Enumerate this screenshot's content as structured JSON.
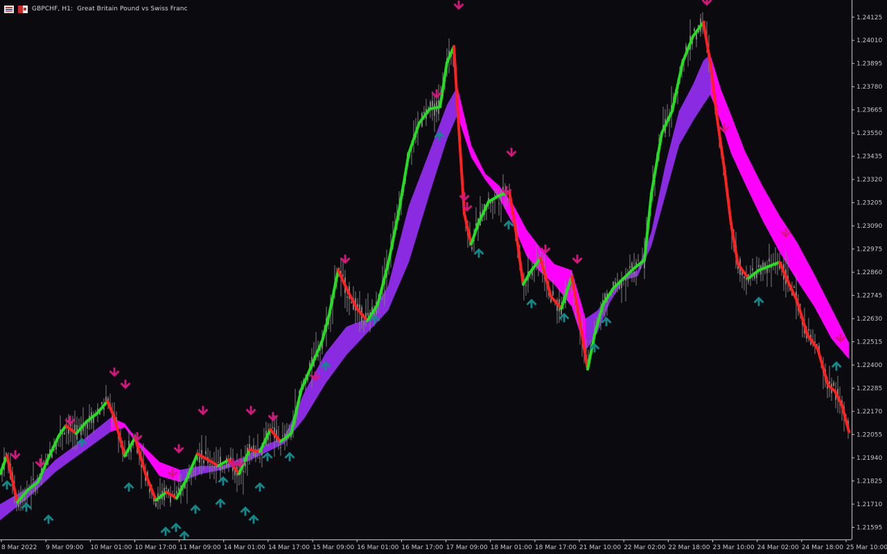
{
  "header": {
    "symbol": "GBPCHF, H1:",
    "description": "Great Britain Pound vs Swiss Franc",
    "icons": [
      "indicator-list-icon",
      "chart-window-icon"
    ]
  },
  "colors": {
    "background": "#0a0a0f",
    "candle": "#7f7f7f",
    "trend_up": "#22e01e",
    "trend_down": "#ff2020",
    "band_up": "#8a2be2",
    "band_down": "#ff00ff",
    "arrow_buy": "#0f8a8a",
    "arrow_sell": "#d8157f",
    "axis": "#c8c8c8"
  },
  "chart_data": {
    "type": "candlestick",
    "symbol": "GBPCHF",
    "timeframe": "H1",
    "y_ticks": [
      "1.24125",
      "1.24010",
      "1.23895",
      "1.23780",
      "1.23665",
      "1.23550",
      "1.23435",
      "1.23320",
      "1.23205",
      "1.23090",
      "1.22975",
      "1.22860",
      "1.22745",
      "1.22630",
      "1.22515",
      "1.22400",
      "1.22285",
      "1.22170",
      "1.22055",
      "1.21940",
      "1.21825",
      "1.21710",
      "1.21595"
    ],
    "ylim": [
      1.21535,
      1.2421
    ],
    "x_ticks": [
      "8 Mar 2022",
      "9 Mar 09:00",
      "10 Mar 01:00",
      "10 Mar 17:00",
      "11 Mar 09:00",
      "14 Mar 01:00",
      "14 Mar 17:00",
      "15 Mar 09:00",
      "16 Mar 01:00",
      "16 Mar 17:00",
      "17 Mar 09:00",
      "18 Mar 01:00",
      "18 Mar 17:00",
      "21 Mar 10:00",
      "22 Mar 02:00",
      "22 Mar 18:00",
      "23 Mar 10:00",
      "24 Mar 02:00",
      "24 Mar 18:00",
      "25 Mar 10:00"
    ],
    "price_path": [
      [
        0,
        1.2186
      ],
      [
        10,
        1.2195
      ],
      [
        25,
        1.2172
      ],
      [
        40,
        1.2178
      ],
      [
        55,
        1.2182
      ],
      [
        70,
        1.2194
      ],
      [
        85,
        1.2205
      ],
      [
        95,
        1.221
      ],
      [
        110,
        1.2206
      ],
      [
        125,
        1.2212
      ],
      [
        140,
        1.2216
      ],
      [
        155,
        1.2222
      ],
      [
        165,
        1.2214
      ],
      [
        180,
        1.2195
      ],
      [
        195,
        1.2204
      ],
      [
        210,
        1.2186
      ],
      [
        225,
        1.2173
      ],
      [
        240,
        1.2177
      ],
      [
        255,
        1.2174
      ],
      [
        270,
        1.2184
      ],
      [
        285,
        1.2196
      ],
      [
        300,
        1.2193
      ],
      [
        315,
        1.219
      ],
      [
        330,
        1.2193
      ],
      [
        345,
        1.2186
      ],
      [
        360,
        1.2198
      ],
      [
        375,
        1.2197
      ],
      [
        390,
        1.2208
      ],
      [
        405,
        1.2202
      ],
      [
        420,
        1.2206
      ],
      [
        435,
        1.2228
      ],
      [
        450,
        1.224
      ],
      [
        465,
        1.2252
      ],
      [
        475,
        1.2265
      ],
      [
        488,
        1.2287
      ],
      [
        500,
        1.2278
      ],
      [
        515,
        1.2268
      ],
      [
        530,
        1.2262
      ],
      [
        545,
        1.227
      ],
      [
        560,
        1.229
      ],
      [
        575,
        1.2315
      ],
      [
        590,
        1.2345
      ],
      [
        605,
        1.236
      ],
      [
        620,
        1.2367
      ],
      [
        635,
        1.2368
      ],
      [
        645,
        1.239
      ],
      [
        655,
        1.2398
      ],
      [
        662,
        1.2358
      ],
      [
        670,
        1.2315
      ],
      [
        680,
        1.23
      ],
      [
        690,
        1.231
      ],
      [
        705,
        1.2321
      ],
      [
        720,
        1.2324
      ],
      [
        735,
        1.2326
      ],
      [
        745,
        1.2305
      ],
      [
        755,
        1.228
      ],
      [
        765,
        1.2286
      ],
      [
        780,
        1.2293
      ],
      [
        795,
        1.2274
      ],
      [
        810,
        1.2268
      ],
      [
        825,
        1.2284
      ],
      [
        835,
        1.2265
      ],
      [
        848,
        1.2238
      ],
      [
        858,
        1.2255
      ],
      [
        870,
        1.227
      ],
      [
        885,
        1.2278
      ],
      [
        900,
        1.2283
      ],
      [
        915,
        1.2288
      ],
      [
        930,
        1.2292
      ],
      [
        940,
        1.2325
      ],
      [
        955,
        1.2355
      ],
      [
        970,
        1.2366
      ],
      [
        985,
        1.239
      ],
      [
        1000,
        1.2403
      ],
      [
        1015,
        1.241
      ],
      [
        1025,
        1.239
      ],
      [
        1035,
        1.2362
      ],
      [
        1045,
        1.2338
      ],
      [
        1055,
        1.231
      ],
      [
        1065,
        1.229
      ],
      [
        1080,
        1.2283
      ],
      [
        1095,
        1.2287
      ],
      [
        1110,
        1.2289
      ],
      [
        1125,
        1.2291
      ],
      [
        1135,
        1.2283
      ],
      [
        1150,
        1.2272
      ],
      [
        1165,
        1.2255
      ],
      [
        1180,
        1.2248
      ],
      [
        1195,
        1.223
      ],
      [
        1205,
        1.2227
      ],
      [
        1215,
        1.222
      ],
      [
        1225,
        1.2207
      ]
    ],
    "band": [
      [
        0,
        1.2164,
        1.217
      ],
      [
        40,
        1.2175,
        1.2178
      ],
      [
        80,
        1.2188,
        1.2192
      ],
      [
        120,
        1.2198,
        1.2202
      ],
      [
        160,
        1.2208,
        1.2213
      ],
      [
        180,
        1.221,
        1.221
      ],
      [
        200,
        1.2201,
        1.2201
      ],
      [
        230,
        1.2186,
        1.2191
      ],
      [
        260,
        1.2183,
        1.2187
      ],
      [
        290,
        1.2187,
        1.2189
      ],
      [
        320,
        1.2189,
        1.2189
      ],
      [
        350,
        1.2192,
        1.2193
      ],
      [
        380,
        1.2197,
        1.2199
      ],
      [
        410,
        1.2202,
        1.2203
      ],
      [
        440,
        1.2215,
        1.2226
      ],
      [
        470,
        1.2232,
        1.2245
      ],
      [
        500,
        1.2246,
        1.2258
      ],
      [
        530,
        1.2257,
        1.2262
      ],
      [
        560,
        1.2268,
        1.2278
      ],
      [
        590,
        1.2292,
        1.2318
      ],
      [
        620,
        1.2326,
        1.2345
      ],
      [
        645,
        1.2353,
        1.2368
      ],
      [
        660,
        1.2365,
        1.2377
      ],
      [
        680,
        1.2344,
        1.2348
      ],
      [
        700,
        1.2333,
        1.2334
      ],
      [
        720,
        1.2324,
        1.2328
      ],
      [
        740,
        1.2311,
        1.2319
      ],
      [
        760,
        1.2295,
        1.2306
      ],
      [
        780,
        1.2287,
        1.2297
      ],
      [
        800,
        1.2281,
        1.2289
      ],
      [
        825,
        1.227,
        1.2286
      ],
      [
        845,
        1.2248,
        1.2262
      ],
      [
        862,
        1.2257,
        1.2266
      ],
      [
        880,
        1.2272,
        1.2275
      ],
      [
        900,
        1.2283,
        1.2283
      ],
      [
        920,
        1.2285,
        1.2286
      ],
      [
        940,
        1.23,
        1.2305
      ],
      [
        960,
        1.2325,
        1.2338
      ],
      [
        980,
        1.235,
        1.2365
      ],
      [
        1000,
        1.2362,
        1.2378
      ],
      [
        1015,
        1.237,
        1.239
      ],
      [
        1025,
        1.2375,
        1.2393
      ],
      [
        1040,
        1.2362,
        1.2376
      ],
      [
        1055,
        1.2346,
        1.2363
      ],
      [
        1075,
        1.2331,
        1.2345
      ],
      [
        1100,
        1.2313,
        1.2328
      ],
      [
        1125,
        1.2297,
        1.2313
      ],
      [
        1150,
        1.2283,
        1.23
      ],
      [
        1175,
        1.227,
        1.2284
      ],
      [
        1200,
        1.2254,
        1.2267
      ],
      [
        1225,
        1.2244,
        1.225
      ]
    ],
    "sell_arrows": [
      [
        22,
        1.2195
      ],
      [
        58,
        1.2191
      ],
      [
        101,
        1.2212
      ],
      [
        165,
        1.2236
      ],
      [
        181,
        1.223
      ],
      [
        198,
        1.2204
      ],
      [
        249,
        1.2186
      ],
      [
        258,
        1.2198
      ],
      [
        293,
        1.2217
      ],
      [
        336,
        1.2191
      ],
      [
        346,
        1.2191
      ],
      [
        362,
        1.2217
      ],
      [
        394,
        1.2214
      ],
      [
        455,
        1.2234
      ],
      [
        498,
        1.2292
      ],
      [
        630,
        1.2374
      ],
      [
        662,
        1.2418
      ],
      [
        670,
        1.2323
      ],
      [
        674,
        1.2318
      ],
      [
        731,
        1.2326
      ],
      [
        738,
        1.2345
      ],
      [
        787,
        1.2297
      ],
      [
        833,
        1.2292
      ],
      [
        1020,
        1.242
      ],
      [
        1045,
        1.2357
      ],
      [
        1134,
        1.2305
      ],
      [
        1213,
        1.2253
      ]
    ],
    "buy_arrows": [
      [
        10,
        1.2181
      ],
      [
        38,
        1.217
      ],
      [
        70,
        1.2164
      ],
      [
        118,
        1.2202
      ],
      [
        186,
        1.218
      ],
      [
        239,
        1.2158
      ],
      [
        254,
        1.216
      ],
      [
        266,
        1.2156
      ],
      [
        282,
        1.2169
      ],
      [
        318,
        1.2172
      ],
      [
        322,
        1.2183
      ],
      [
        354,
        1.2168
      ],
      [
        366,
        1.2164
      ],
      [
        375,
        1.218
      ],
      [
        386,
        1.2195
      ],
      [
        418,
        1.2195
      ],
      [
        470,
        1.224
      ],
      [
        541,
        1.2263
      ],
      [
        634,
        1.2354
      ],
      [
        691,
        1.2296
      ],
      [
        734,
        1.231
      ],
      [
        767,
        1.2271
      ],
      [
        814,
        1.2264
      ],
      [
        858,
        1.2249
      ],
      [
        875,
        1.2262
      ],
      [
        1095,
        1.2272
      ],
      [
        1207,
        1.224
      ]
    ]
  }
}
